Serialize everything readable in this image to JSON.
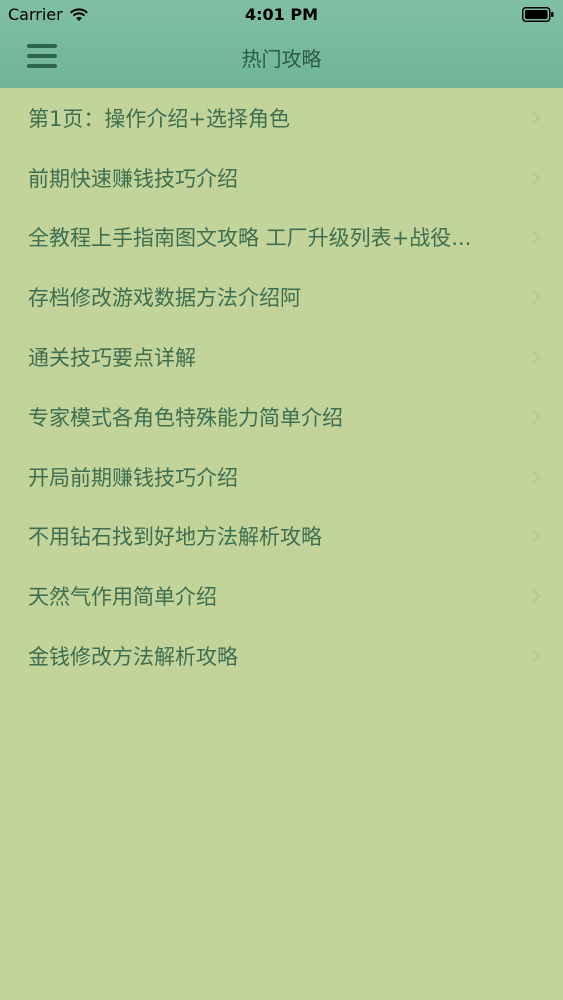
{
  "status_bar": {
    "carrier": "Carrier",
    "time": "4:01 PM"
  },
  "nav_bar": {
    "title": "热门攻略",
    "menu_icon": "hamburger-icon"
  },
  "list": {
    "items": [
      {
        "label": "第1页：操作介绍+选择角色"
      },
      {
        "label": "前期快速赚钱技巧介绍"
      },
      {
        "label": "全教程上手指南图文攻略 工厂升级列表+战役..."
      },
      {
        "label": "存档修改游戏数据方法介绍阿"
      },
      {
        "label": "通关技巧要点详解"
      },
      {
        "label": "专家模式各角色特殊能力简单介绍"
      },
      {
        "label": "开局前期赚钱技巧介绍"
      },
      {
        "label": "不用钻石找到好地方法解析攻略"
      },
      {
        "label": "天然气作用简单介绍"
      },
      {
        "label": "金钱修改方法解析攻略"
      }
    ]
  },
  "colors": {
    "background": "#c3d49b",
    "nav_bar": "#77ba9f",
    "text": "#3d6e50",
    "title": "#2d5a47",
    "chevron": "#b7c995"
  }
}
